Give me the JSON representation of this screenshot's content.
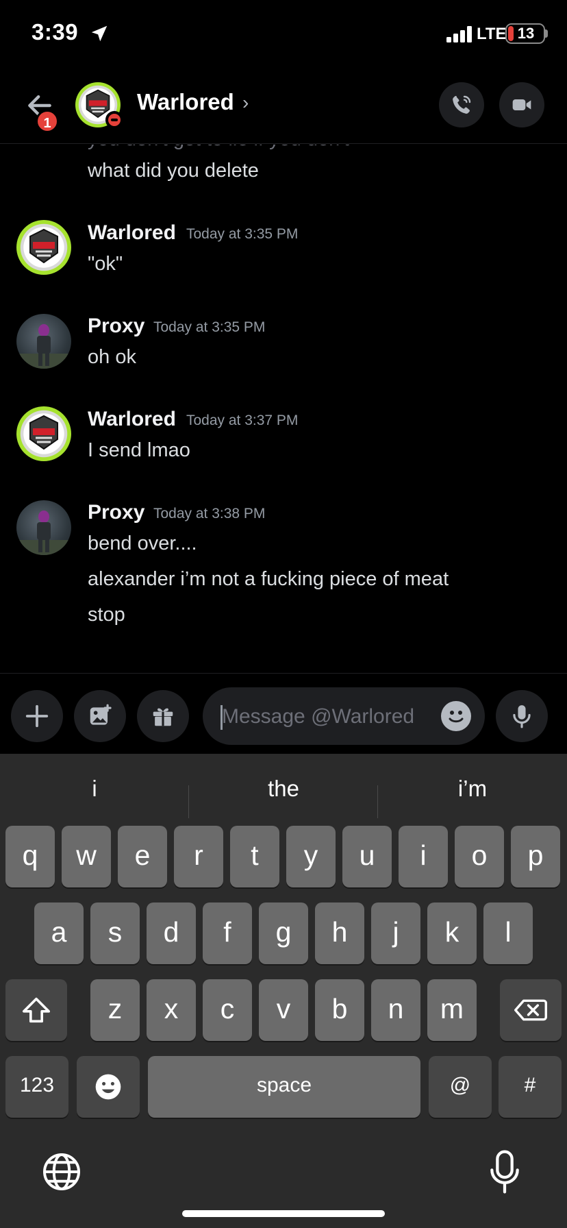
{
  "status_bar": {
    "time": "3:39",
    "network": "LTE",
    "battery": "13"
  },
  "header": {
    "title": "Warlored",
    "back_badge": "1"
  },
  "messages": {
    "partial_top": "what did you delete",
    "groups": [
      {
        "author": "Warlored",
        "timestamp": "Today at 3:35 PM",
        "lines": [
          "\"ok\""
        ]
      },
      {
        "author": "Proxy",
        "timestamp": "Today at 3:35 PM",
        "lines": [
          "oh ok"
        ]
      },
      {
        "author": "Warlored",
        "timestamp": "Today at 3:37 PM",
        "lines": [
          "I send lmao"
        ]
      },
      {
        "author": "Proxy",
        "timestamp": "Today at 3:38 PM",
        "lines": [
          "bend over....",
          "alexander i’m not a fucking piece of meat",
          "stop"
        ]
      }
    ]
  },
  "composer": {
    "placeholder": "Message @Warlored"
  },
  "keyboard": {
    "suggestions": [
      "i",
      "the",
      "i’m"
    ],
    "row1": [
      "q",
      "w",
      "e",
      "r",
      "t",
      "y",
      "u",
      "i",
      "o",
      "p"
    ],
    "row2": [
      "a",
      "s",
      "d",
      "f",
      "g",
      "h",
      "j",
      "k",
      "l"
    ],
    "row3": [
      "z",
      "x",
      "c",
      "v",
      "b",
      "n",
      "m"
    ],
    "numbers_label": "123",
    "space_label": "space",
    "at_label": "@",
    "hash_label": "#"
  },
  "colors": {
    "background": "#000000",
    "dnd_red": "#e5413a",
    "avatar_ring": "#a6e22e",
    "keyboard_bg": "#2b2b2b",
    "key": "#6b6b6b",
    "key_dark": "#464646"
  }
}
